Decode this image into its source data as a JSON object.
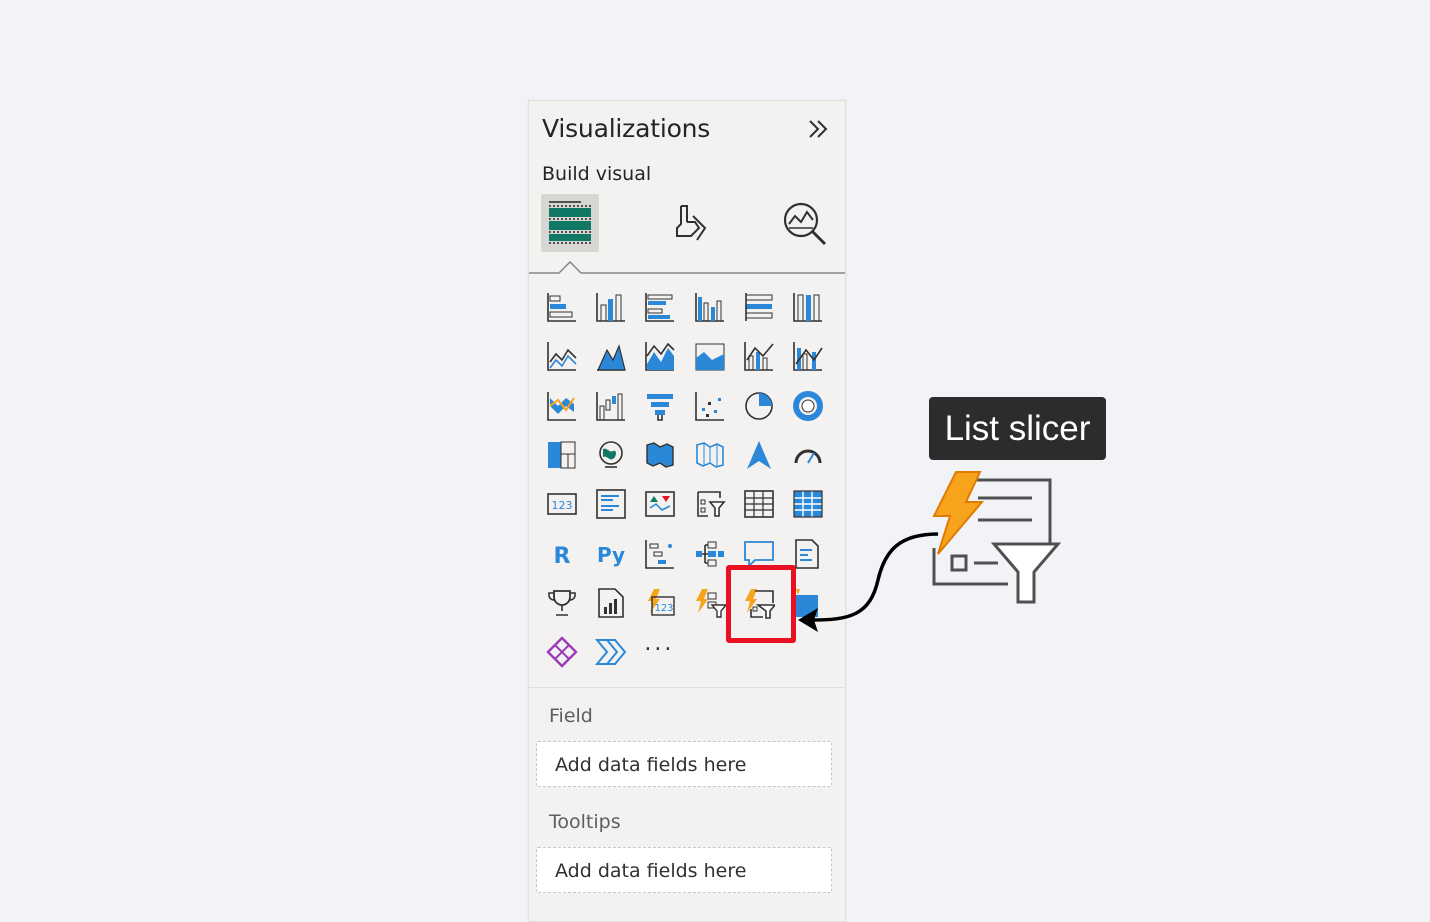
{
  "panel": {
    "title": "Visualizations",
    "subtitle": "Build visual",
    "mode_tabs": [
      {
        "icon": "build-visual-icon",
        "active": true
      },
      {
        "icon": "format-visual-icon",
        "active": false
      },
      {
        "icon": "analytics-icon",
        "active": false
      }
    ],
    "more_label": "...",
    "wells": [
      {
        "label": "Field",
        "placeholder": "Add data fields here"
      },
      {
        "label": "Tooltips",
        "placeholder": "Add data fields here"
      }
    ]
  },
  "visual_icons": [
    "stacked-bar-chart-icon",
    "stacked-column-chart-icon",
    "clustered-bar-chart-icon",
    "clustered-column-chart-icon",
    "100-stacked-bar-chart-icon",
    "100-stacked-column-chart-icon",
    "line-chart-icon",
    "area-chart-icon",
    "stacked-area-chart-icon",
    "100-stacked-area-chart-icon",
    "line-and-stacked-column-chart-icon",
    "line-and-clustered-column-chart-icon",
    "ribbon-chart-icon",
    "waterfall-chart-icon",
    "funnel-icon",
    "scatter-chart-icon",
    "pie-chart-icon",
    "donut-chart-icon",
    "treemap-icon",
    "map-icon",
    "filled-map-icon",
    "shape-map-icon",
    "azure-map-icon",
    "gauge-icon",
    "card-icon",
    "multi-row-card-icon",
    "kpi-icon",
    "slicer-icon",
    "table-icon",
    "matrix-icon",
    "r-script-visual-icon",
    "python-visual-icon",
    "key-influencers-icon",
    "decomposition-tree-icon",
    "q-and-a-icon",
    "smart-narrative-icon",
    "metrics-icon",
    "paginated-report-icon",
    "card-new-icon",
    "button-slicer-icon",
    "list-slicer-icon",
    "power-apps-icon",
    "power-apps-diamond-icon",
    "power-automate-icon",
    "more-visuals-icon"
  ],
  "callout": {
    "label": "List slicer",
    "icon": "list-slicer-large-icon",
    "colors": {
      "highlight": "#e81123",
      "tooltip_bg": "#2c2c2c",
      "accent": "#2b88d8",
      "bolt": "#f7a31c"
    }
  }
}
